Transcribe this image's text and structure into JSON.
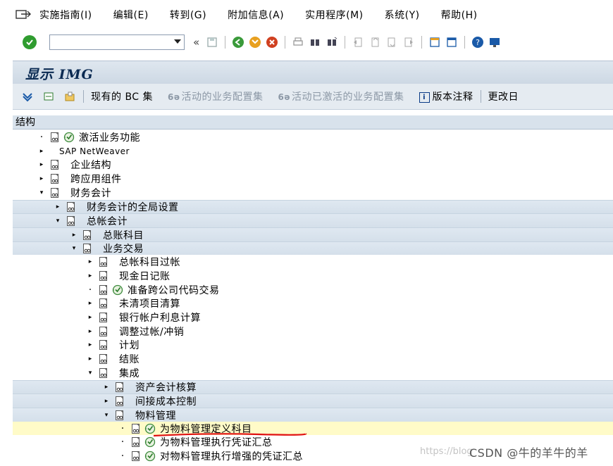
{
  "menubar": {
    "items": [
      "实施指南(I)",
      "编辑(E)",
      "转到(G)",
      "附加信息(A)",
      "实用程序(M)",
      "系统(Y)",
      "帮助(H)"
    ]
  },
  "toolbar": {
    "command_field_value": ""
  },
  "title": "显示 IMG",
  "app_toolbar": {
    "current_bc_set": "现有的 BC 集",
    "active_bc_set": "活动的业务配置集",
    "activated_bc_set": "活动已激活的业务配置集",
    "release_notes": "版本注释",
    "change_log": "更改日"
  },
  "tree": {
    "header": "结构",
    "rows": [
      {
        "label": "激活业务功能"
      },
      {
        "label": "SAP NetWeaver"
      },
      {
        "label": "企业结构"
      },
      {
        "label": "跨应用组件"
      },
      {
        "label": "财务会计"
      },
      {
        "label": "财务会计的全局设置"
      },
      {
        "label": "总帐会计"
      },
      {
        "label": "总账科目"
      },
      {
        "label": "业务交易"
      },
      {
        "label": "总帐科目过帐"
      },
      {
        "label": "现金日记账"
      },
      {
        "label": "准备跨公司代码交易"
      },
      {
        "label": "未清项目清算"
      },
      {
        "label": "银行帐户利息计算"
      },
      {
        "label": "调整过帐/冲销"
      },
      {
        "label": "计划"
      },
      {
        "label": "结账"
      },
      {
        "label": "集成"
      },
      {
        "label": "资产会计核算"
      },
      {
        "label": "间接成本控制"
      },
      {
        "label": "物料管理"
      },
      {
        "label": "为物料管理定义科目"
      },
      {
        "label": "为物料管理执行凭证汇总"
      },
      {
        "label": "对物料管理执行增强的凭证汇总"
      }
    ]
  },
  "watermark": {
    "url": "https://blog",
    "text": "CSDN @牛的羊牛的羊"
  },
  "colors": {
    "highlight": "#fffbc8",
    "underline": "#e01010",
    "title": "#0a2a52"
  }
}
